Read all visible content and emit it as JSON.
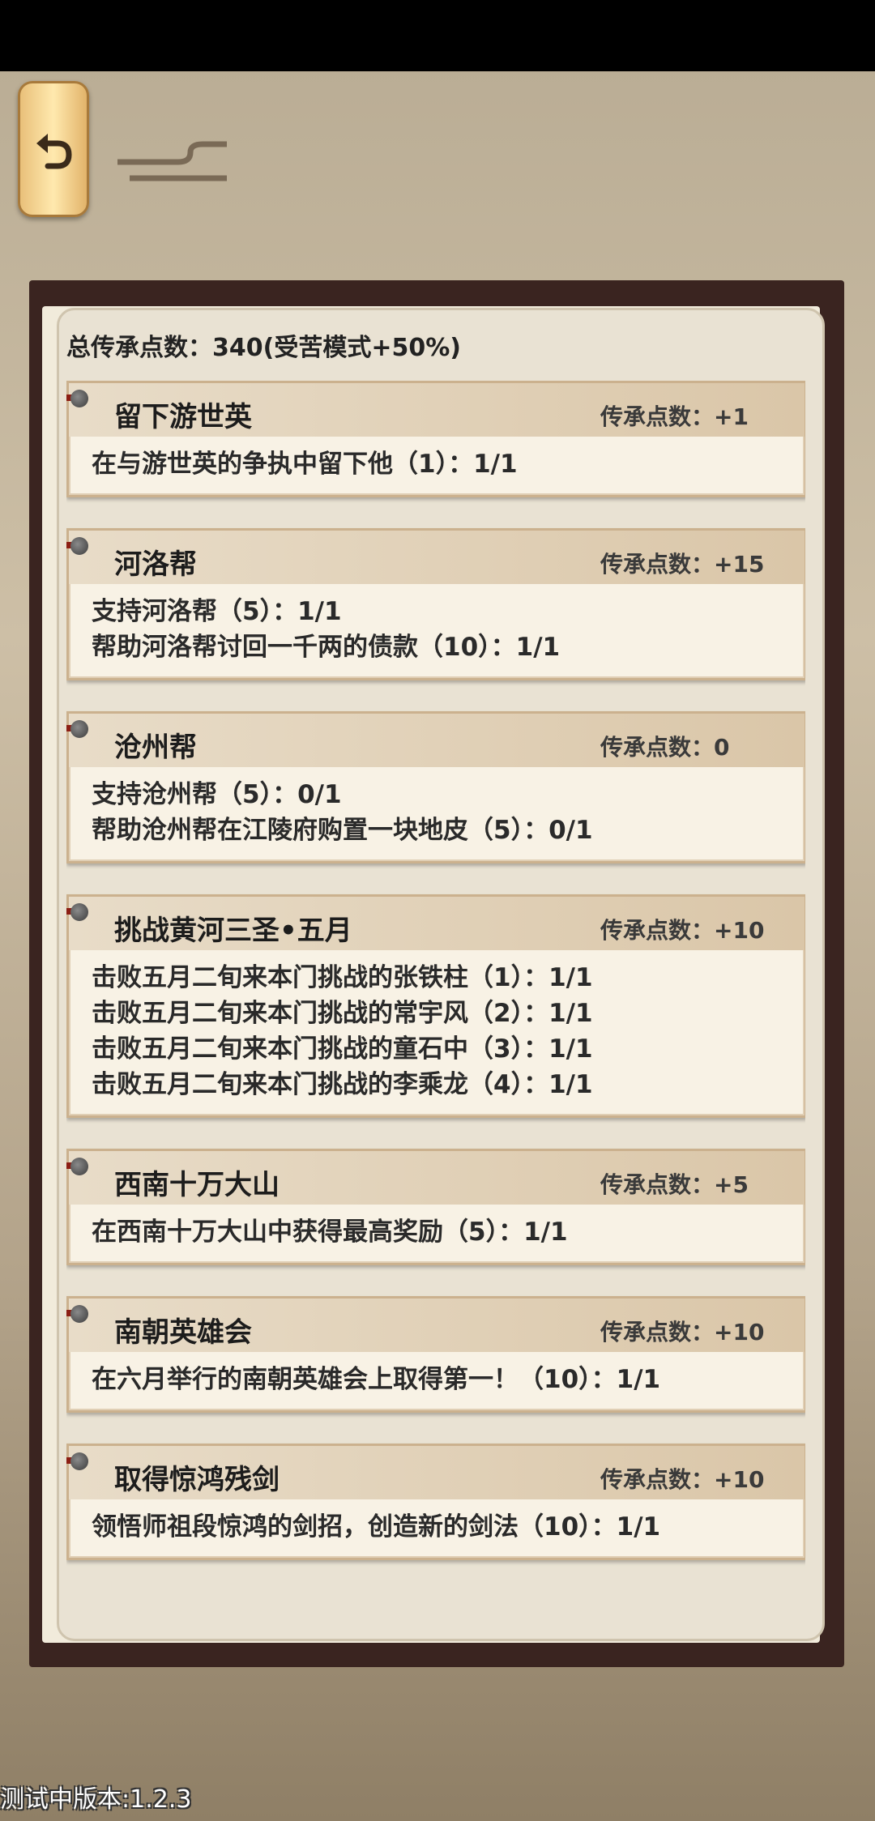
{
  "header": {
    "back_icon": "undo-arrow-icon"
  },
  "total_label": "总传承点数：340(受苦模式+50%)",
  "cards": [
    {
      "title": "留下游世英",
      "points": "传承点数：+1",
      "lines": [
        "在与游世英的争执中留下他（1）：1/1"
      ]
    },
    {
      "title": "河洛帮",
      "points": "传承点数：+15",
      "lines": [
        "支持河洛帮（5）：1/1",
        "帮助河洛帮讨回一千两的债款（10）：1/1"
      ]
    },
    {
      "title": "沧州帮",
      "points": "传承点数：0",
      "lines": [
        "支持沧州帮（5）：0/1",
        "帮助沧州帮在江陵府购置一块地皮（5）：0/1"
      ]
    },
    {
      "title": "挑战黄河三圣•五月",
      "points": "传承点数：+10",
      "lines": [
        "击败五月二旬来本门挑战的张铁柱（1）：1/1",
        "击败五月二旬来本门挑战的常宇风（2）：1/1",
        "击败五月二旬来本门挑战的童石中（3）：1/1",
        "击败五月二旬来本门挑战的李乘龙（4）：1/1"
      ]
    },
    {
      "title": "西南十万大山",
      "points": "传承点数：+5",
      "lines": [
        "在西南十万大山中获得最高奖励（5）：1/1"
      ]
    },
    {
      "title": "南朝英雄会",
      "points": "传承点数：+10",
      "lines": [
        "在六月举行的南朝英雄会上取得第一！（10）：1/1"
      ]
    },
    {
      "title": "取得惊鸿残剑",
      "points": "传承点数：+10",
      "lines": [
        "领悟师祖段惊鸿的剑招，创造新的剑法（10）：1/1"
      ]
    }
  ],
  "version": "测试中版本:1.2.3"
}
